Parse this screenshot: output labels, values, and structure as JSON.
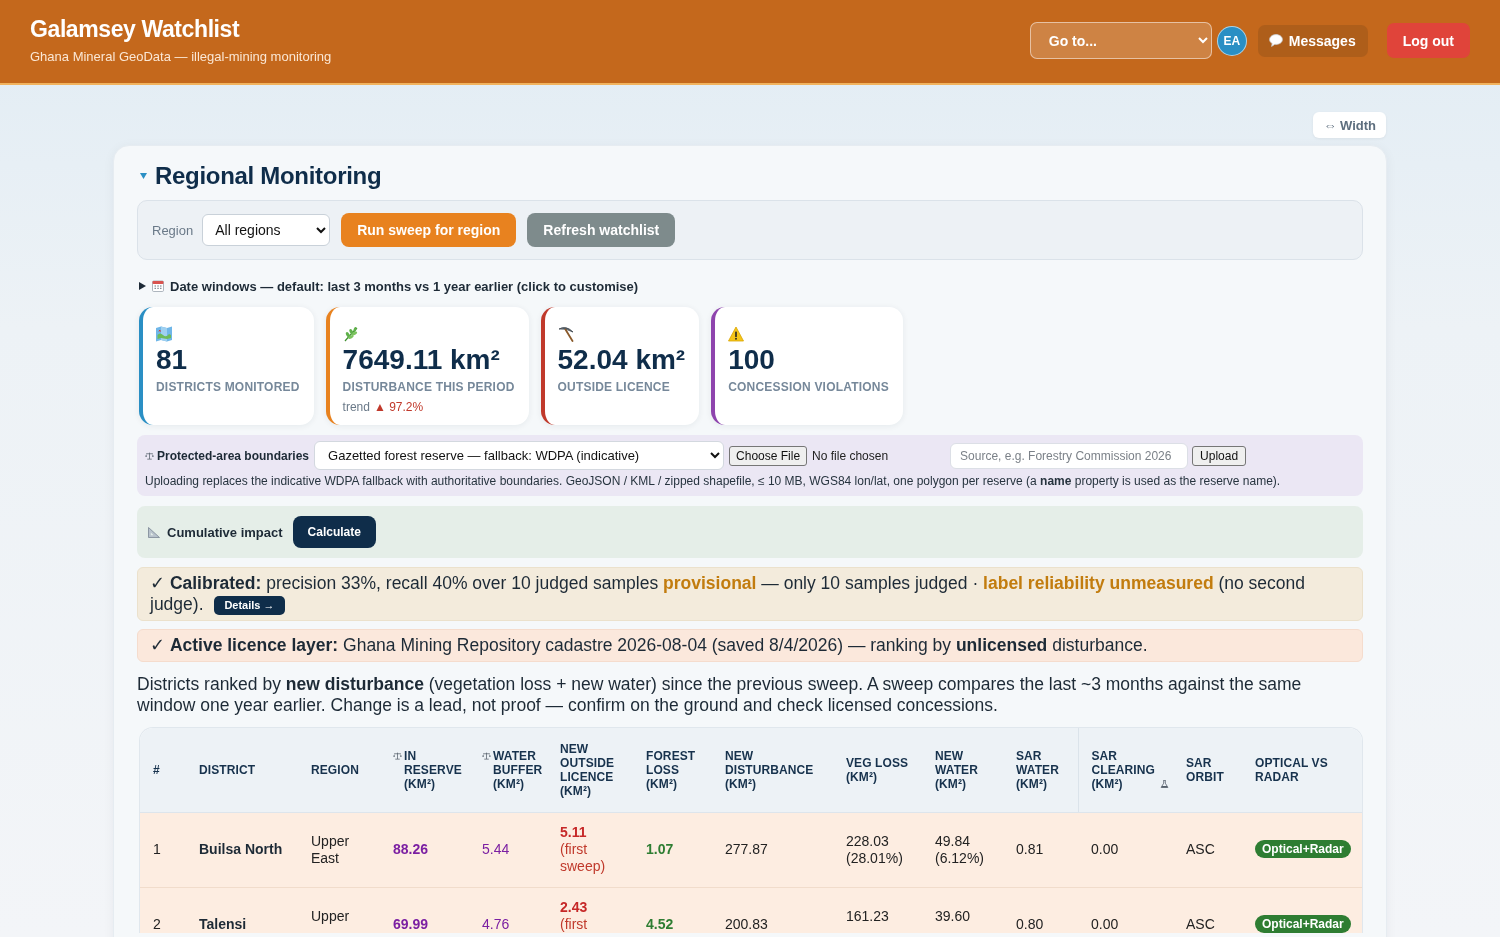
{
  "header": {
    "title": "Galamsey Watchlist",
    "subtitle": "Ghana Mineral GeoData — illegal-mining monitoring",
    "goto_select": {
      "value": "Go to..."
    },
    "avatar": {
      "initials": "EA"
    },
    "messages_button": "Messages",
    "logout_button": "Log out"
  },
  "width_button": "⇔ Width",
  "section": {
    "title": "Regional Monitoring",
    "expanded": true
  },
  "toolbar": {
    "region_label": "Region",
    "region_select": {
      "value": "All regions"
    },
    "run_button": "Run sweep for region",
    "refresh_button": "Refresh watchlist"
  },
  "date_windows": {
    "expanded": false,
    "summary": "Date windows — default: last 3 months vs 1 year earlier (click to customise)"
  },
  "stats": [
    {
      "kind": "map",
      "value": "81",
      "label": "DISTRICTS MONITORED",
      "color": "#2a8fc4"
    },
    {
      "kind": "leaf",
      "value": "7649.11 km²",
      "label": "DISTURBANCE THIS PERIOD",
      "color": "#e8821f",
      "trend": {
        "label": "trend",
        "value": "▲ 97.2%"
      }
    },
    {
      "kind": "pickaxe",
      "value": "52.04 km²",
      "label": "OUTSIDE LICENCE",
      "color": "#c0392b"
    },
    {
      "kind": "warning",
      "value": "100",
      "label": "CONCESSION VIOLATIONS",
      "color": "#8e44ad"
    }
  ],
  "protected_areas": {
    "label": "Protected-area boundaries",
    "select": {
      "value": "Gazetted forest reserve — fallback: WDPA (indicative)"
    },
    "file_button": "Choose File",
    "file_status": "No file chosen",
    "source_field": {
      "placeholder": "Source, e.g. Forestry Commission 2026"
    },
    "upload_button": "Upload",
    "note": "Uploading replaces the indicative WDPA fallback with authoritative boundaries. GeoJSON / KML / zipped shapefile, ≤ 10 MB, WGS84 lon/lat, one polygon per reserve (a **name** property is used as the reserve name)."
  },
  "cumulative": {
    "label": "Cumulative impact",
    "button": "Calculate"
  },
  "calibration": {
    "segments": [
      {
        "kind": "plain",
        "text": "✓"
      },
      {
        "kind": "bold",
        "text": "Calibrated:"
      },
      {
        "kind": "plain",
        "text": "precision 33%, recall 40% over 10 judged samples"
      },
      {
        "kind": "warn",
        "text": "provisional"
      },
      {
        "kind": "plain",
        "text": "— only 10 samples judged ·"
      },
      {
        "kind": "warn",
        "text": "label reliability unmeasured"
      },
      {
        "kind": "plain",
        "text": "(no second judge)."
      }
    ],
    "details_button": "Details →"
  },
  "licence": {
    "text": "✓ **Active licence layer:** Ghana Mining Repository cadastre 2026-08-04 (saved 8/4/2026) — ranking by **unlicensed** disturbance."
  },
  "intro": "Districts ranked by **new disturbance** (vegetation loss + new water) since the previous sweep. A sweep compares the last ~3 months against the same window one year earlier. Change is a lead, not proof — confirm on the ground and check licensed concessions.",
  "table": {
    "columns": [
      {
        "label": "#",
        "kind": "plain"
      },
      {
        "label": "DISTRICT",
        "kind": "plain"
      },
      {
        "label": "REGION",
        "kind": "plain"
      },
      {
        "label": "IN RESERVE (KM²)",
        "kind": "protected"
      },
      {
        "label": "WATER BUFFER (KM²)",
        "kind": "protected"
      },
      {
        "label": "NEW OUTSIDE LICENCE (KM²)",
        "kind": "plain"
      },
      {
        "label": "FOREST LOSS (KM²)",
        "kind": "plain"
      },
      {
        "label": "NEW DISTURBANCE (KM²)",
        "kind": "plain"
      },
      {
        "label": "VEG LOSS (KM²)",
        "kind": "plain"
      },
      {
        "label": "NEW WATER (KM²)",
        "kind": "plain"
      },
      {
        "label": "SAR WATER (KM²)",
        "kind": "plain"
      },
      {
        "label": "SAR CLEARING (KM²)",
        "kind": "experimental"
      },
      {
        "label": "SAR ORBIT",
        "kind": "plain"
      },
      {
        "label": "OPTICAL VS RADAR",
        "kind": "plain"
      }
    ],
    "rows": [
      {
        "highlighted": true,
        "rank": "1",
        "district": "Builsa North",
        "region": "Upper East",
        "in_reserve": "88.26",
        "water_buffer": "5.44",
        "outside_licence": {
          "value": "5.11",
          "note": "(first sweep)"
        },
        "forest_loss": "1.07",
        "new_disturbance": "277.87",
        "veg_loss": "228.03 (28.01%)",
        "new_water": "49.84 (6.12%)",
        "sar_water": "0.81",
        "sar_clearing": "0.00",
        "sar_orbit": "ASC",
        "optical_vs_radar": "Optical+Radar"
      },
      {
        "highlighted": true,
        "rank": "2",
        "district": "Talensi",
        "region": "Upper",
        "in_reserve": "69.99",
        "water_buffer": "4.76",
        "outside_licence": {
          "value": "2.43",
          "note": "(first"
        },
        "forest_loss": "4.52",
        "new_disturbance": "200.83",
        "veg_loss": "161.23",
        "new_water": "39.60",
        "sar_water": "0.80",
        "sar_clearing": "0.00",
        "sar_orbit": "ASC",
        "optical_vs_radar": "Optical+Radar"
      }
    ]
  }
}
